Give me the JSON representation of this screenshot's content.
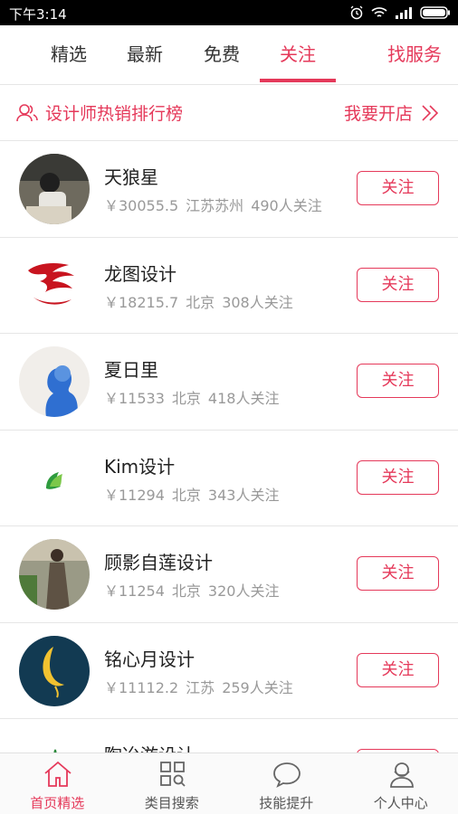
{
  "status": {
    "time": "下午3:14"
  },
  "tabs": [
    {
      "label": "精选",
      "active": false
    },
    {
      "label": "最新",
      "active": false
    },
    {
      "label": "免费",
      "active": false
    },
    {
      "label": "关注",
      "active": true
    },
    {
      "label": "找服务",
      "active": false
    }
  ],
  "banner": {
    "title": "设计师热销排行榜",
    "action": "我要开店"
  },
  "designers": [
    {
      "name": "天狼星",
      "price": "￥30055.5",
      "location": "江苏苏州",
      "followers": "490人关注",
      "button": "关注",
      "avatar": "photo-person-avatar"
    },
    {
      "name": "龙图设计",
      "price": "￥18215.7",
      "location": "北京",
      "followers": "308人关注",
      "button": "关注",
      "avatar": "red-dragon-logo"
    },
    {
      "name": "夏日里",
      "price": "￥11533",
      "location": "北京",
      "followers": "418人关注",
      "button": "关注",
      "avatar": "silhouette-avatar"
    },
    {
      "name": "Kim设计",
      "price": "￥11294",
      "location": "北京",
      "followers": "343人关注",
      "button": "关注",
      "avatar": "green-leaf-logo"
    },
    {
      "name": "顾影自莲设计",
      "price": "￥11254",
      "location": "北京",
      "followers": "320人关注",
      "button": "关注",
      "avatar": "photo-person-avatar"
    },
    {
      "name": "铭心月设计",
      "price": "￥11112.2",
      "location": "江苏",
      "followers": "259人关注",
      "button": "关注",
      "avatar": "moon-logo"
    },
    {
      "name": "陶冶游设计",
      "price": "",
      "location": "",
      "followers": "",
      "button": "关注",
      "avatar": "green-logo"
    }
  ],
  "bottom_nav": [
    {
      "label": "首页精选",
      "icon": "home-icon",
      "active": true
    },
    {
      "label": "类目搜索",
      "icon": "category-search-icon",
      "active": false
    },
    {
      "label": "技能提升",
      "icon": "chat-bubble-icon",
      "active": false
    },
    {
      "label": "个人中心",
      "icon": "user-icon",
      "active": false
    }
  ],
  "colors": {
    "accent": "#e5395a",
    "text": "#222222",
    "muted": "#999999"
  }
}
